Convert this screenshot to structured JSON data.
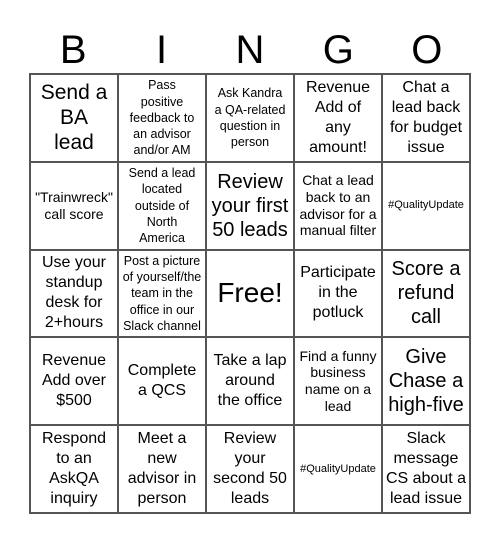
{
  "header": {
    "letters": [
      "B",
      "I",
      "N",
      "G",
      "O"
    ]
  },
  "cells": [
    "Send a\nBA\nlead",
    "Pass\npositive\nfeedback to\nan advisor\nand/or AM",
    "Ask Kandra\na QA-related\nquestion in\nperson",
    "Revenue\nAdd of\nany\namount!",
    "Chat a\nlead back\nfor budget\nissue",
    "\"Trainwreck\"\ncall score",
    "Send a lead\nlocated\noutside of\nNorth\nAmerica",
    "Review\nyour first\n50 leads",
    "Chat a lead\nback to an\nadvisor for a\nmanual filter",
    "#QualityUpdate",
    "Use your\nstandup\ndesk for\n2+hours",
    "Post a picture\nof yourself/the\nteam in the\noffice in our\nSlack channel",
    "Free!",
    "Participate\nin the\npotluck",
    "Score a\nrefund\ncall",
    "Revenue\nAdd over\n$500",
    "Complete\na QCS",
    "Take a lap\naround\nthe office",
    "Find a funny\nbusiness\nname on a\nlead",
    "Give\nChase a\nhigh-five",
    "Respond\nto an\nAskQA\ninquiry",
    "Meet a\nnew\nadvisor in\nperson",
    "Review\nyour\nsecond 50\nleads",
    "#QualityUpdate",
    "Slack\nmessage\nCS about a\nlead issue"
  ]
}
